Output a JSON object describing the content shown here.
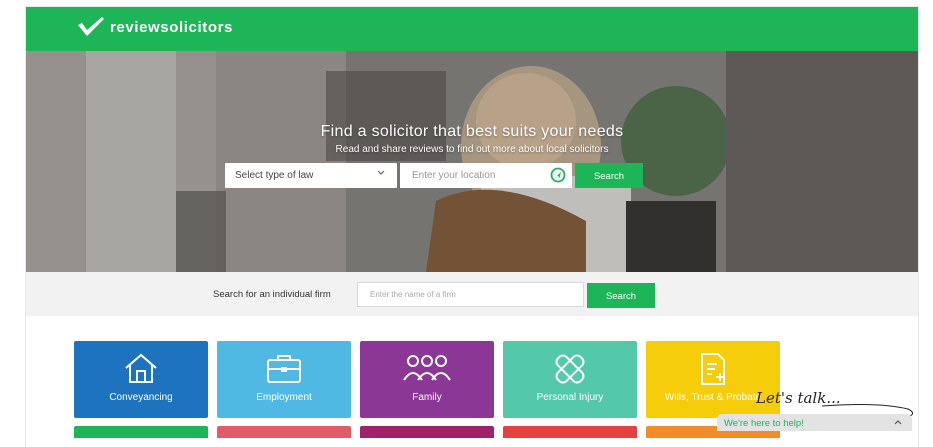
{
  "brand": {
    "name": "reviewsolicitors",
    "color": "#1db557"
  },
  "hero": {
    "title": "Find a solicitor that best suits your needs",
    "subtitle": "Read and share reviews to find out more about local solicitors",
    "law_select": {
      "value": "Select type of law",
      "icon": "chevron-down-icon"
    },
    "location": {
      "placeholder": "Enter your location",
      "icon": "locate-icon"
    },
    "search_label": "Search"
  },
  "firm_search": {
    "label": "Search for an individual firm",
    "placeholder": "Enter the name of a firm",
    "search_label": "Search"
  },
  "categories": [
    {
      "label": "Conveyancing",
      "color": "#1e73be",
      "icon": "house-icon"
    },
    {
      "label": "Employment",
      "color": "#4fb9e3",
      "icon": "briefcase-icon"
    },
    {
      "label": "Family",
      "color": "#8a3796",
      "icon": "family-icon"
    },
    {
      "label": "Personal Injury",
      "color": "#54c9aa",
      "icon": "bandage-icon"
    },
    {
      "label": "Wills, Trust & Probate",
      "color": "#f6cd0a",
      "icon": "document-icon"
    }
  ],
  "second_row_colors": [
    "#1db557",
    "#e25b6a",
    "#a0226a",
    "#e4413f",
    "#f28c28"
  ],
  "chat": {
    "tagline": "Let's talk...",
    "prompt": "We're here to help!"
  }
}
